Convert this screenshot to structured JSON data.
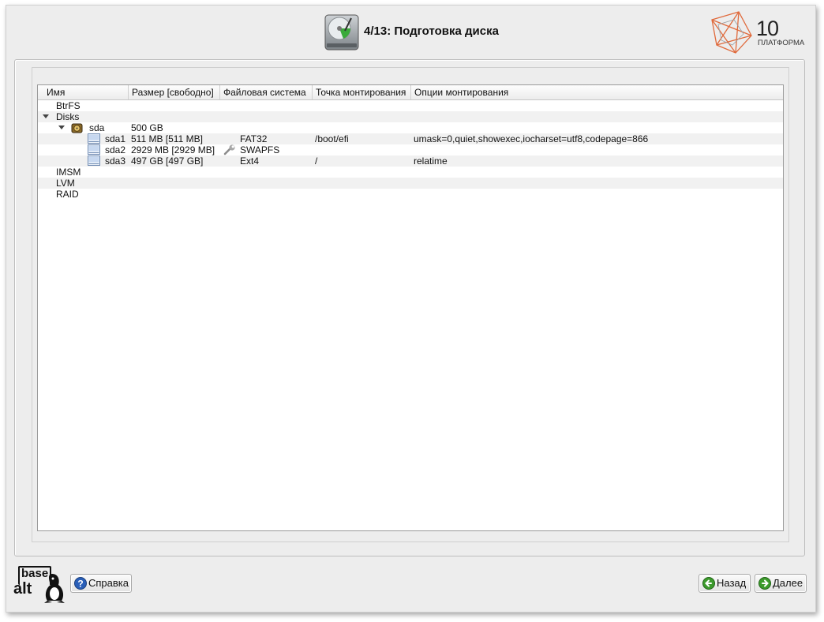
{
  "header": {
    "title": "4/13: Подготовка диска",
    "brand_number": "10",
    "brand_name": "ПЛАТФОРМА"
  },
  "tree": {
    "columns": [
      "Имя",
      "Размер [свободно]",
      "Файловая система",
      "Точка монтирования",
      "Опции монтирования"
    ],
    "rows": [
      {
        "name": "BtrFS",
        "size": "",
        "fs": "",
        "mount": "",
        "options": ""
      },
      {
        "name": "Disks",
        "size": "",
        "fs": "",
        "mount": "",
        "options": ""
      },
      {
        "name": "sda",
        "size": "500 GB",
        "fs": "",
        "mount": "",
        "options": ""
      },
      {
        "name": "sda1",
        "size": "511 MB [511 MB]",
        "fs": "FAT32",
        "mount": "/boot/efi",
        "options": "umask=0,quiet,showexec,iocharset=utf8,codepage=866"
      },
      {
        "name": "sda2",
        "size": "2929 MB [2929 MB]",
        "fs": "SWAPFS",
        "mount": "",
        "options": ""
      },
      {
        "name": "sda3",
        "size": "497 GB [497 GB]",
        "fs": "Ext4",
        "mount": "/",
        "options": "relatime"
      },
      {
        "name": "IMSM",
        "size": "",
        "fs": "",
        "mount": "",
        "options": ""
      },
      {
        "name": "LVM",
        "size": "",
        "fs": "",
        "mount": "",
        "options": ""
      },
      {
        "name": "RAID",
        "size": "",
        "fs": "",
        "mount": "",
        "options": ""
      }
    ]
  },
  "footer": {
    "logo_top": "base",
    "logo_bottom": "alt",
    "help_label": "Справка",
    "back_label": "Назад",
    "next_label": "Далее"
  },
  "icons": {
    "header": "hard-disk-icon",
    "disk": "disk-drive-icon",
    "partition": "partition-icon",
    "swap": "wrench-icon",
    "help": "help-icon",
    "back": "back-arrow-icon",
    "next": "next-arrow-icon"
  },
  "colors": {
    "window_bg": "#ededed",
    "accent_green": "#3c9a2c",
    "help_blue": "#2a5fb8",
    "brand_orange": "#e06a3c"
  }
}
